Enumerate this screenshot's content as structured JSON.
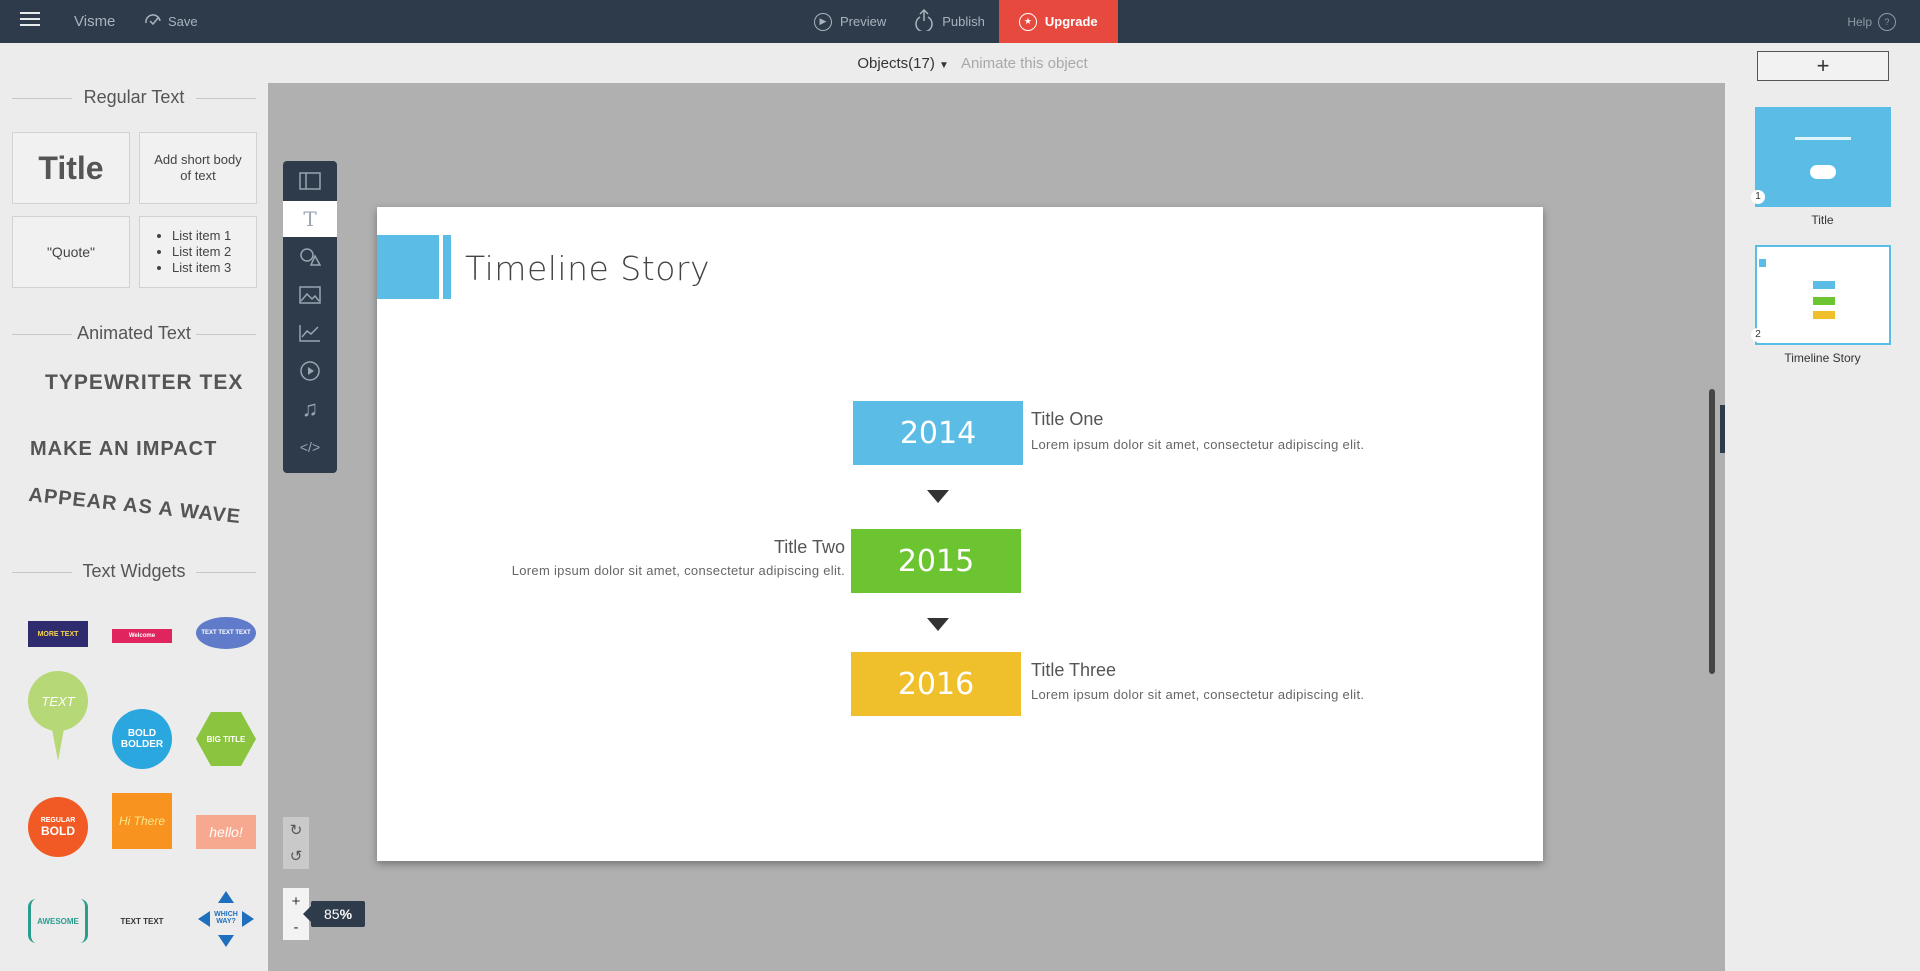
{
  "topbar": {
    "brand": "Visme",
    "save": "Save",
    "preview": "Preview",
    "publish": "Publish",
    "upgrade": "Upgrade",
    "help": "Help",
    "help_icon": "?"
  },
  "subbar": {
    "objects": "Objects(17)",
    "animate": "Animate this object"
  },
  "left_panel": {
    "regular_text_title": "Regular Text",
    "tiles": {
      "title": "Title",
      "body": "Add short body of text",
      "quote": "\"Quote\"",
      "list": [
        "List item 1",
        "List item 2",
        "List item 3"
      ]
    },
    "animated_text_title": "Animated Text",
    "animated": {
      "typewriter": "TYPEWRITER TEX",
      "impact": "MAKE AN IMPACT",
      "wave": "APPEAR AS A WAVE"
    },
    "text_widgets_title": "Text Widgets",
    "widgets": {
      "w1": "MORE TEXT",
      "w2": "Welcome",
      "w3": "TEXT TEXT TEXT",
      "w4": "TEXT",
      "w5_line1": "BOLD",
      "w5_line2": "BOLDER",
      "w6": "BIG TITLE",
      "w7_line1": "REGULAR",
      "w7_line2": "BOLD",
      "w8": "Hi There",
      "w9": "hello!",
      "w10": "AWESOME",
      "w11": "TEXT TEXT",
      "w12": "WHICH WAY?"
    }
  },
  "slide": {
    "title": "Timeline Story",
    "timeline": [
      {
        "year": "2014",
        "title": "Title One",
        "body": "Lorem ipsum dolor sit amet, consectetur adipiscing elit.",
        "color": "#5bbde6"
      },
      {
        "year": "2015",
        "title": "Title Two",
        "body": "Lorem ipsum dolor sit amet, consectetur adipiscing elit.",
        "color": "#6cc431"
      },
      {
        "year": "2016",
        "title": "Title Three",
        "body": "Lorem ipsum dolor sit amet, consectetur adipiscing elit.",
        "color": "#f0bf2c"
      }
    ]
  },
  "zoom": {
    "value": "85",
    "unit": "%",
    "plus": "+",
    "minus": "-"
  },
  "right_panel": {
    "add": "+",
    "slides": [
      {
        "num": "1",
        "label": "Title"
      },
      {
        "num": "2",
        "label": "Timeline Story"
      }
    ]
  },
  "tools": [
    "layout-icon",
    "text-icon",
    "shapes-icon",
    "image-icon",
    "chart-icon",
    "video-icon",
    "audio-icon",
    "embed-icon"
  ],
  "colors": {
    "topbar": "#2e3b4b",
    "upgrade": "#e8493e",
    "accent_blue": "#5bbde6",
    "green": "#6cc431",
    "yellow": "#f0bf2c"
  }
}
